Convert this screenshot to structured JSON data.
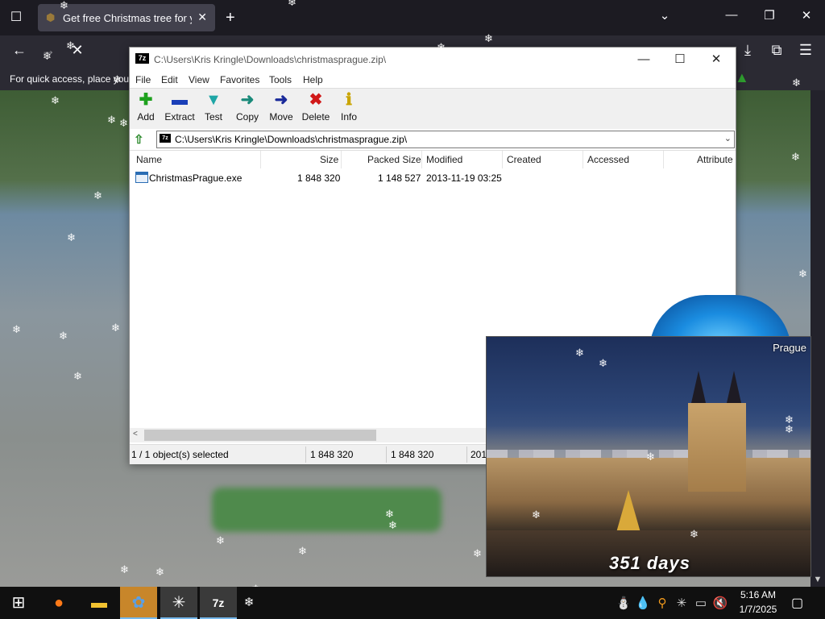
{
  "browser": {
    "tab_title": "Get free Christmas tree for your",
    "tab_close": "✕",
    "new_tab": "+",
    "bookmarks_notice": "For quick access, place your",
    "list_tabs_icon": "☐",
    "back_icon": "←",
    "forward_icon": "→",
    "stop_icon": "✕",
    "download_icon": "⤓",
    "extensions_icon": "⧉",
    "menu_icon": "☰",
    "minimize": "—",
    "maximize": "❐",
    "close": "✕",
    "list_all_tabs": "⌄"
  },
  "zip": {
    "logo": "7z",
    "title": "C:\\Users\\Kris Kringle\\Downloads\\christmasprague.zip\\",
    "win_minimize": "—",
    "win_maximize": "☐",
    "win_close": "✕",
    "menu": [
      "File",
      "Edit",
      "View",
      "Favorites",
      "Tools",
      "Help"
    ],
    "toolbar": [
      {
        "label": "Add",
        "icon": "✚",
        "color": "#1ea11e"
      },
      {
        "label": "Extract",
        "icon": "▬",
        "color": "#1a3fb8"
      },
      {
        "label": "Test",
        "icon": "▼",
        "color": "#1ea6a6"
      },
      {
        "label": "Copy",
        "icon": "➜",
        "color": "#1a8a7a"
      },
      {
        "label": "Move",
        "icon": "➜",
        "color": "#1a2a9a"
      },
      {
        "label": "Delete",
        "icon": "✖",
        "color": "#d01818"
      },
      {
        "label": "Info",
        "icon": "ℹ",
        "color": "#c9a400"
      }
    ],
    "address": "C:\\Users\\Kris Kringle\\Downloads\\christmasprague.zip\\",
    "address_drop": "⌄",
    "up_icon": "⇧",
    "columns": [
      "Name",
      "Size",
      "Packed Size",
      "Modified",
      "Created",
      "Accessed",
      "Attribute"
    ],
    "files": [
      {
        "name": "ChristmasPrague.exe",
        "size": "1 848 320",
        "packed": "1 148 527",
        "modified": "2013-11-19 03:25",
        "created": "",
        "accessed": ""
      }
    ],
    "scroll_left": "<",
    "status": {
      "selected": "1 / 1 object(s) selected",
      "size": "1 848 320",
      "packed": "1 848 320",
      "date": "201"
    }
  },
  "widget": {
    "label": "Prague",
    "countdown": "351 days"
  },
  "taskbar": {
    "start_icon": "⊞",
    "apps": [
      {
        "name": "firefox",
        "icon": "●",
        "color": "#ff7a18"
      },
      {
        "name": "file-explorer",
        "icon": "▬",
        "color": "#f2c230"
      },
      {
        "name": "christmas-app",
        "icon": "✿",
        "color": "#5aa0e6"
      },
      {
        "name": "snowflake-app",
        "icon": "✳",
        "color": "#ffffff"
      },
      {
        "name": "7zip",
        "icon": "7z",
        "color": "#ffffff"
      },
      {
        "name": "snow-tray",
        "icon": "❄",
        "color": "#ffffff"
      }
    ],
    "tray": [
      "⛄",
      "💧",
      "⚲",
      "✳",
      "▭",
      "🔇"
    ],
    "time": "5:16 AM",
    "date": "1/7/2025",
    "notifications_icon": "▢"
  },
  "colors": {
    "accent": "#76b9ed",
    "browser_bg": "#1c1b22"
  }
}
